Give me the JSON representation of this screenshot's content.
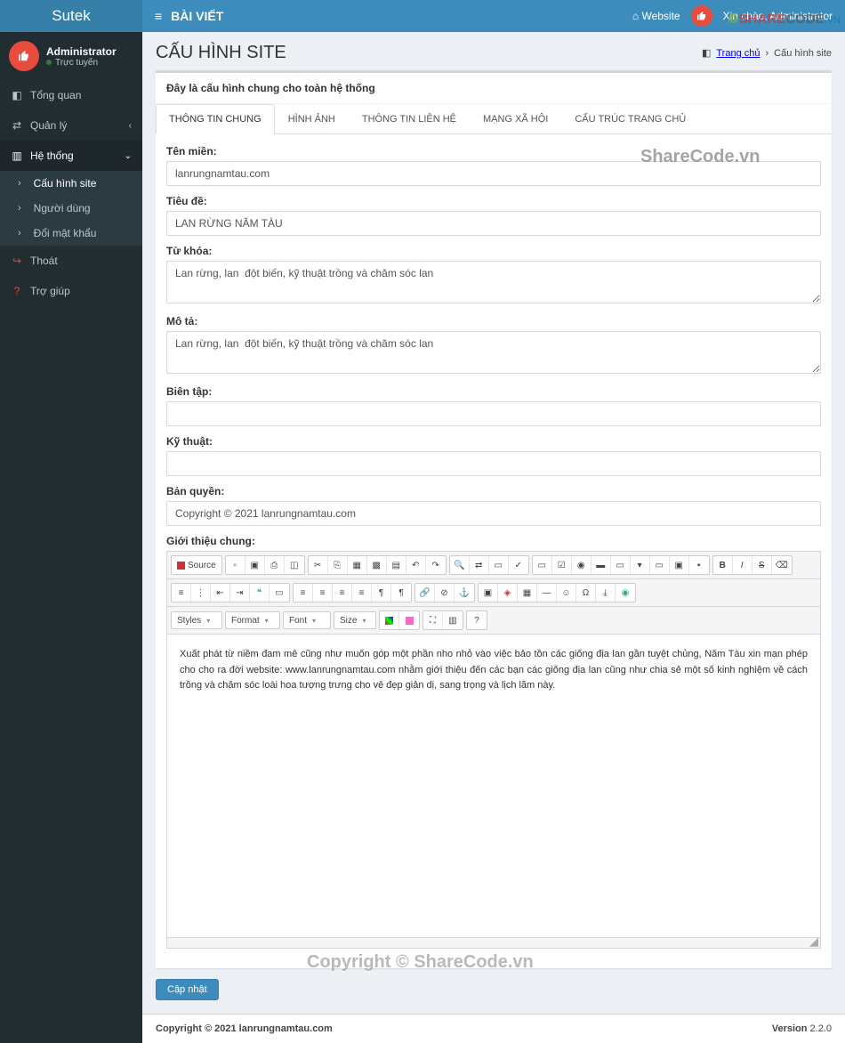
{
  "brand": "Sutek",
  "topbar": {
    "title": "BÀI VIẾT",
    "website": "Website",
    "greeting": "Xin chào, Administrator"
  },
  "user": {
    "name": "Administrator",
    "status": "Trực tuyến"
  },
  "nav": {
    "overview": "Tổng quan",
    "manage": "Quản lý",
    "system": "Hệ thống",
    "sub": {
      "site": "Cấu hình site",
      "users": "Người dùng",
      "password": "Đổi mật khẩu"
    },
    "logout": "Thoát",
    "help": "Trợ giúp"
  },
  "page": {
    "title": "CẤU HÌNH SITE",
    "crumb_home": "Trang chủ",
    "crumb_current": "Cấu hình site"
  },
  "box": {
    "header": "Đây là cấu hình chung cho toàn hệ thống"
  },
  "tabs": {
    "t1": "THÔNG TIN CHUNG",
    "t2": "HÌNH ẢNH",
    "t3": "THÔNG TIN LIÊN HỆ",
    "t4": "MẠNG XÃ HỘI",
    "t5": "CẤU TRÚC TRANG CHỦ"
  },
  "form": {
    "domain_label": "Tên miền:",
    "domain_value": "lanrungnamtau.com",
    "title_label": "Tiêu đề:",
    "title_value": "LAN RỪNG NĂM TÀU",
    "keywords_label": "Từ khóa:",
    "keywords_value": "Lan rừng, lan  đột biến, kỹ thuật trồng và chăm sóc lan",
    "desc_label": "Mô tả:",
    "desc_value": "Lan rừng, lan  đột biến, kỹ thuật trồng và chăm sóc lan",
    "editor_label": "Biên tập:",
    "editor_value": "",
    "tech_label": "Kỹ thuật:",
    "tech_value": "",
    "copyright_label": "Bản quyền:",
    "copyright_value": "Copyright © 2021 lanrungnamtau.com",
    "intro_label": "Giới thiệu chung:",
    "intro_value": "Xuất phát từ niềm đam mê cũng như muốn góp một phần nho nhỏ vào việc bảo tồn các giống địa lan gần tuyệt chủng, Năm Tàu xin mạn phép cho cho ra đời website: www.lanrungnamtau.com nhằm giới thiệu đến các bạn các giống địa lan cũng như chia sẻ một số kinh nghiệm về cách trồng và chăm sóc loài hoa tượng trưng cho vẻ đẹp giản dị, sang trọng và lịch lãm này.",
    "submit": "Cập nhật"
  },
  "toolbar": {
    "source": "Source",
    "styles": "Styles",
    "format": "Format",
    "font": "Font",
    "size": "Size"
  },
  "footer": {
    "copyright": "Copyright © 2021 lanrungnamtau.com",
    "version_label": "Version",
    "version": "2.2.0"
  },
  "watermark": {
    "sc": "ShareCode.vn",
    "cp": "Copyright © ShareCode.vn"
  }
}
